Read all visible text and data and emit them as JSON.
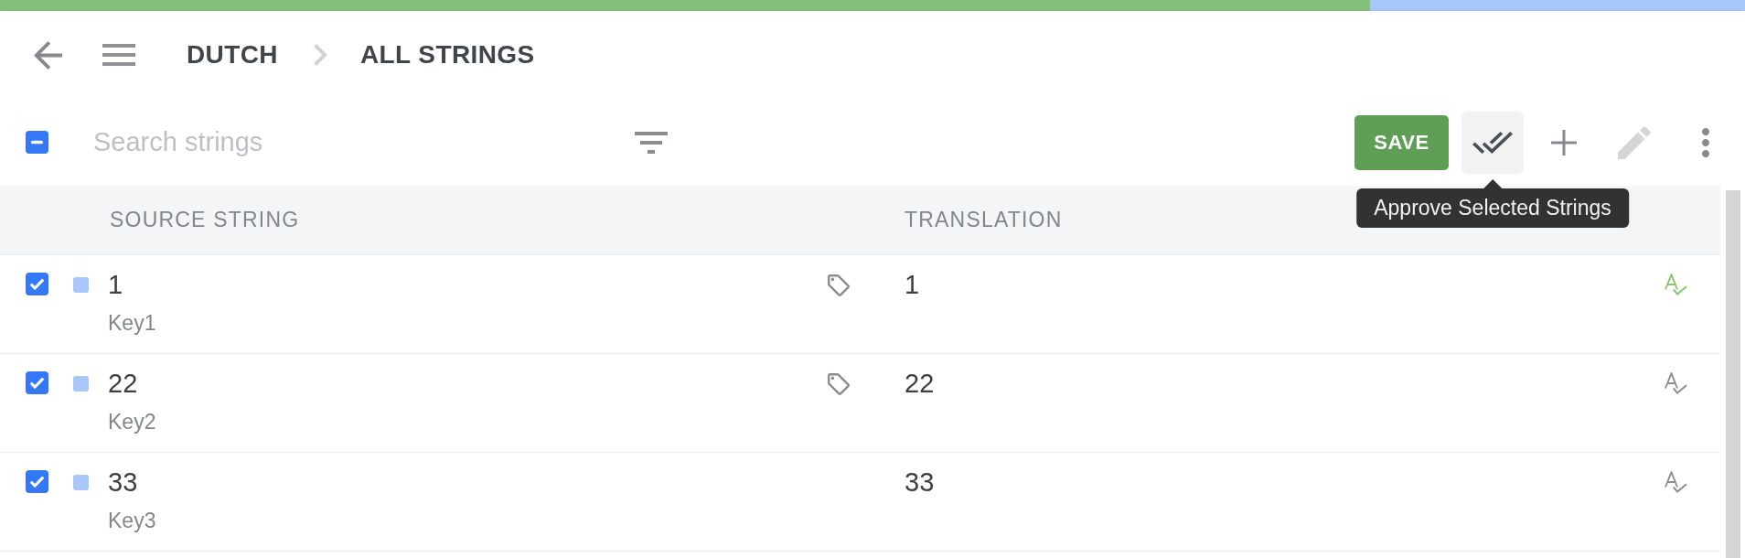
{
  "progress": {
    "level": 0.785
  },
  "header": {
    "breadcrumb": [
      "DUTCH",
      "ALL STRINGS"
    ]
  },
  "toolbar": {
    "select_all": {
      "indeterminate": true
    },
    "search": {
      "placeholder": "Search strings"
    },
    "actions": [
      {
        "kind": "save",
        "label": "SAVE",
        "disabled": false,
        "hovered": false
      },
      {
        "kind": "approve",
        "disabled": false,
        "hovered": true
      },
      {
        "kind": "add",
        "disabled": false,
        "hovered": false
      },
      {
        "kind": "edit",
        "disabled": true,
        "hovered": false
      },
      {
        "kind": "more",
        "disabled": false,
        "hovered": false
      }
    ],
    "tooltip": {
      "text": "Approve Selected Strings"
    }
  },
  "table": {
    "columns": [
      "SOURCE STRING",
      "TRANSLATION"
    ],
    "rows": [
      {
        "checked": true,
        "color": "#a9c8f9",
        "source": "1",
        "key": "Key1",
        "tagged": true,
        "translation": "1",
        "approved": true
      },
      {
        "checked": true,
        "color": "#a9c8f9",
        "source": "22",
        "key": "Key2",
        "tagged": true,
        "translation": "22",
        "approved": false
      },
      {
        "checked": true,
        "color": "#a9c8f9",
        "source": "33",
        "key": "Key3",
        "tagged": false,
        "translation": "33",
        "approved": false
      }
    ]
  }
}
